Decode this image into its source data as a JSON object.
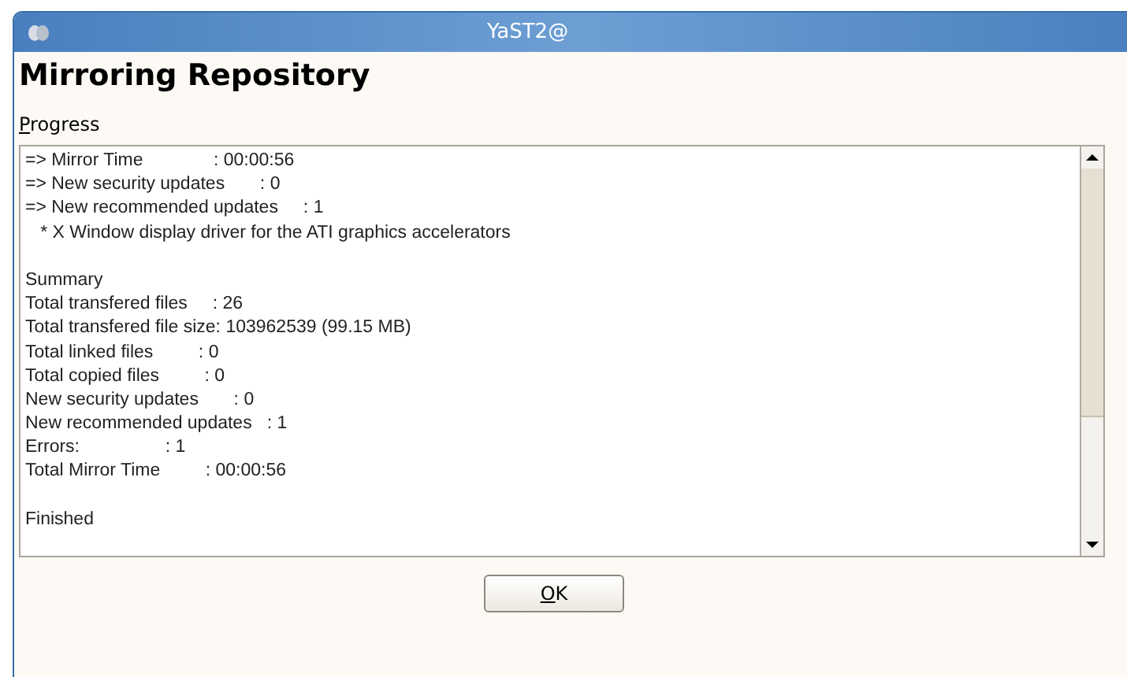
{
  "window": {
    "title": "YaST2@"
  },
  "heading": "Mirroring Repository",
  "progress": {
    "label": "Progress",
    "first_letter_underlined": true,
    "sections": [
      [
        "=> Mirror Time              : 00:00:56",
        "=> New security updates       : 0",
        "=> New recommended updates     : 1",
        "   * X Window display driver for the ATI graphics accelerators"
      ],
      [
        "Summary",
        "Total transfered files     : 26",
        "Total transfered file size: 103962539 (99.15 MB)",
        "Total linked files         : 0",
        "Total copied files         : 0",
        "New security updates       : 0",
        "New recommended updates   : 1",
        "Errors:                 : 1",
        "Total Mirror Time         : 00:00:56"
      ],
      [
        "Finished"
      ]
    ]
  },
  "buttons": [
    {
      "label": "OK",
      "first_letter_underlined": true
    }
  ]
}
